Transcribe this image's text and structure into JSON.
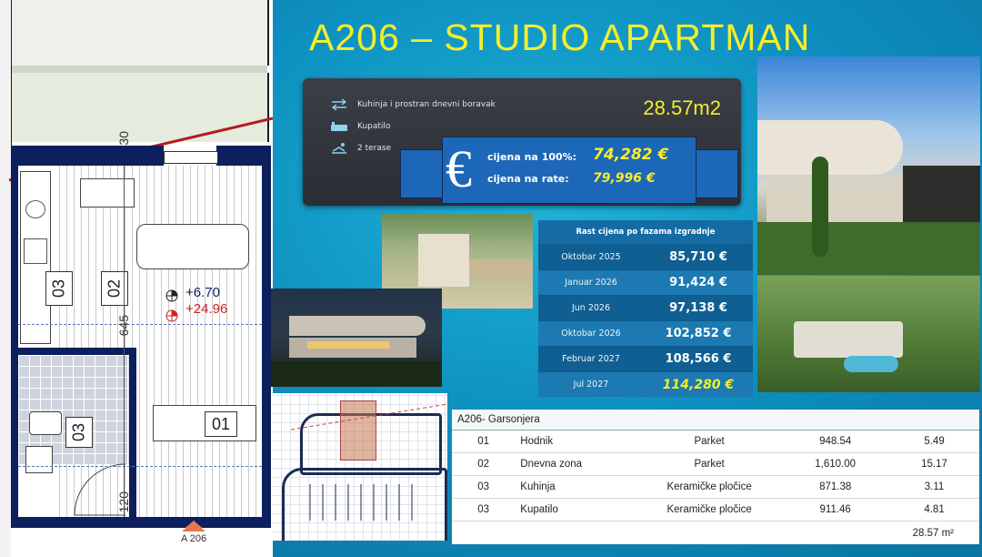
{
  "title": "A206 – STUDIO  APARTMAN",
  "features": [
    {
      "icon": "arrows-icon",
      "label": "Kuhinja i prostran dnevni boravak"
    },
    {
      "icon": "bathtub-icon",
      "label": "Kupatilo"
    },
    {
      "icon": "sunbed-icon",
      "label": "2 terase"
    }
  ],
  "area": "28.57m2",
  "prices": {
    "full_label": "cijena  na 100%:",
    "full_value": "74,282 €",
    "rate_label": "cijena  na rate:",
    "rate_value": "79,996 €"
  },
  "price_growth": {
    "header": "Rast cijena po fazama izgradnje",
    "rows": [
      {
        "month": "Oktobar 2025",
        "value": "85,710 €"
      },
      {
        "month": "Januar 2026",
        "value": "91,424 €"
      },
      {
        "month": "Jun 2026",
        "value": "97,138 €"
      },
      {
        "month": "Oktobar 2026",
        "value": "102,852 €"
      },
      {
        "month": "Februar 2027",
        "value": "108,566 €"
      },
      {
        "month": "Jul 2027",
        "value": "114,280 €"
      }
    ]
  },
  "room_table": {
    "title": "A206- Garsonjera",
    "rows": [
      {
        "no": "01",
        "room": "Hodnik",
        "floor": "Parket",
        "value": "948.54",
        "area": "5.49"
      },
      {
        "no": "02",
        "room": "Dnevna zona",
        "floor": "Parket",
        "value": "1,610.00",
        "area": "15.17"
      },
      {
        "no": "03",
        "room": "Kuhinja",
        "floor": "Keramičke pločice",
        "value": "871.38",
        "area": "3.11"
      },
      {
        "no": "03",
        "room": "Kupatilo",
        "floor": "Keramičke pločice",
        "value": "911.46",
        "area": "4.81"
      }
    ],
    "total": "28.57 m²"
  },
  "floor_plan": {
    "tag_03a": "03",
    "tag_02": "02",
    "tag_03b": "03",
    "tag_01": "01",
    "dim_30": "30",
    "dim_645": "645",
    "dim_120": "120",
    "level_plus": "+6.70",
    "level_red": "+24.96",
    "unit_label": "A 206"
  }
}
